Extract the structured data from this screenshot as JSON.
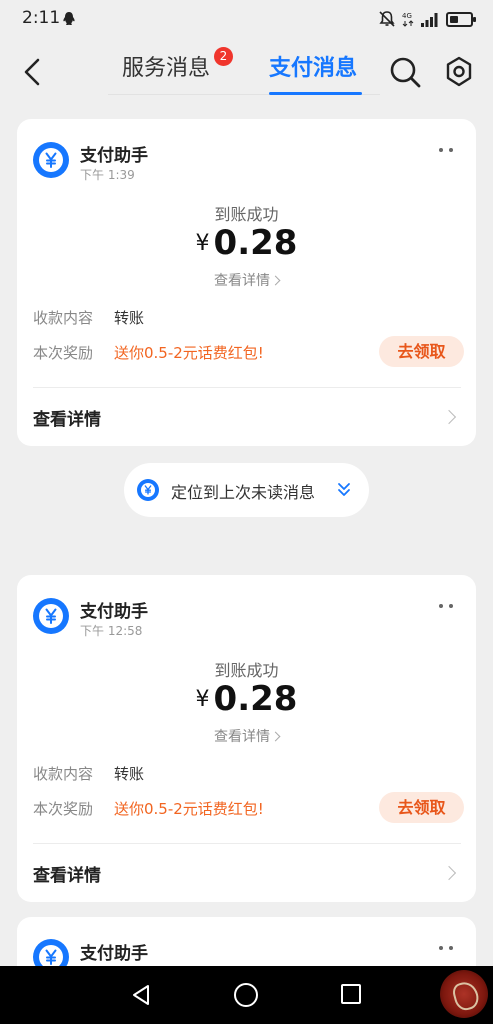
{
  "status_bar": {
    "time": "2:11",
    "net": "4G"
  },
  "header": {
    "tabs": [
      {
        "label": "服务消息",
        "badge": "2"
      },
      {
        "label": "支付消息",
        "active": true
      }
    ]
  },
  "accent_color": "#1677ff",
  "cards": [
    {
      "sender": "支付助手",
      "time": "下午 1:39",
      "title": "到账成功",
      "currency": "¥",
      "amount": "0.28",
      "detail_link": "查看详情",
      "content_label": "收款内容",
      "content_value": "转账",
      "reward_label": "本次奖励",
      "reward_value": "送你0.5-2元话费红包!",
      "claim_button": "去领取",
      "footer_link": "查看详情"
    },
    {
      "sender": "支付助手",
      "time": "下午 12:58",
      "title": "到账成功",
      "currency": "¥",
      "amount": "0.28",
      "detail_link": "查看详情",
      "content_label": "收款内容",
      "content_value": "转账",
      "reward_label": "本次奖励",
      "reward_value": "送你0.5-2元话费红包!",
      "claim_button": "去领取",
      "footer_link": "查看详情"
    },
    {
      "sender": "支付助手"
    }
  ],
  "jump_pill": {
    "label": "定位到上次未读消息"
  },
  "icons": [
    "qq-icon",
    "mute-icon",
    "signal-icon",
    "battery-icon",
    "back-icon",
    "search-icon",
    "gear-icon",
    "yuan-logo-icon",
    "more-icon",
    "chevron-right-icon",
    "chevron-down-double-icon",
    "nav-back-icon",
    "nav-home-icon",
    "nav-recent-icon"
  ]
}
